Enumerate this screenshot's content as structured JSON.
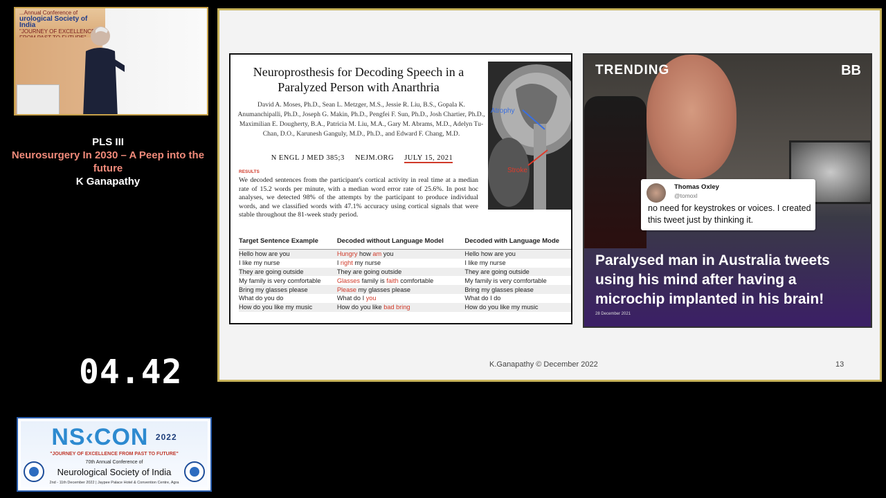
{
  "speaker_video": {
    "banner_line1": "...Annual Conference of",
    "banner_line2": "urological Society of India",
    "banner_line3": "\"JOURNEY OF EXCELLENCE FROM PAST TO FUTURE\""
  },
  "session": {
    "label": "PLS III",
    "title": "Neurosurgery In 2030 – A Peep into the future",
    "speaker": "K Ganapathy"
  },
  "timer": "04.42",
  "conference": {
    "logo_text": "NS‹CON",
    "year": "2022",
    "tagline": "\"JOURNEY OF EXCELLENCE FROM PAST TO FUTURE\"",
    "annual": "70th Annual Conference of",
    "society": "Neurological Society of India",
    "venue": "2nd - 11th December 2022 | Jaypee Palace Hotel & Convention Centre, Agra"
  },
  "slide": {
    "paper": {
      "title": "Neuroprosthesis for Decoding Speech in a Paralyzed Person with Anarthria",
      "authors": "David A. Moses, Ph.D., Sean L. Metzger, M.S., Jessie R. Liu, B.S., Gopala K. Anumanchipalli, Ph.D., Joseph G. Makin, Ph.D., Pengfei F. Sun, Ph.D., Josh Chartier, Ph.D., Maximilian E. Dougherty, B.A., Patricia M. Liu, M.A., Gary M. Abrams, M.D., Adelyn Tu-Chan, D.O., Karunesh Ganguly, M.D., Ph.D., and Edward F. Chang, M.D.",
      "journal": "N ENGL J MED 385;3",
      "site": "NEJM.ORG",
      "date": "JULY 15, 2021",
      "results_label": "RESULTS",
      "results_text": "We decoded sentences from the participant's cortical activity in real time at a median rate of 15.2 words per minute, with a median word error rate of 25.6%. In post hoc analyses, we detected 98% of the attempts by the participant to produce individual words, and we classified words with 47.1% accuracy using cortical signals that were stable throughout the 81-week study period.",
      "mri_label_atrophy": "Atrophy",
      "mri_label_stroke": "Stroke",
      "table_headers": [
        "Target Sentence Example",
        "Decoded without Language Model",
        "Decoded with Language Mode"
      ],
      "table_rows": [
        [
          "Hello how are you",
          "<span class='err'>Hungry</span> how <span class='err'>am</span> you",
          "Hello how are you"
        ],
        [
          "I like my nurse",
          "I <span class='err'>right</span> my nurse",
          "I like my nurse"
        ],
        [
          "They are going outside",
          "They are going outside",
          "They are going outside"
        ],
        [
          "My family is very comfortable",
          "<span class='err'>Glasses</span> family is <span class='err'>faith</span> comfortable",
          "My family is very comfortable"
        ],
        [
          "Bring my glasses please",
          "<span class='err'>Please</span> my glasses please",
          "Bring my glasses please"
        ],
        [
          "What do you do",
          "What do I <span class='err'>you</span>",
          "What do I do"
        ],
        [
          "How do you like my music",
          "How do you like <span class='err'>bad bring</span>",
          "How do you like my music"
        ]
      ]
    },
    "news": {
      "brand": "TRENDING",
      "logo": "BB",
      "tweet_name": "Thomas Oxley",
      "tweet_handle": "@tomoxl",
      "tweet_text": "no need for keystrokes or voices. I created this tweet just by thinking it.",
      "headline": "Paralysed man in Australia tweets using his mind after having a microchip implanted in his brain!",
      "date": "28 December 2021"
    },
    "footer": "K.Ganapathy   ©  December    2022",
    "page_number": "13"
  }
}
